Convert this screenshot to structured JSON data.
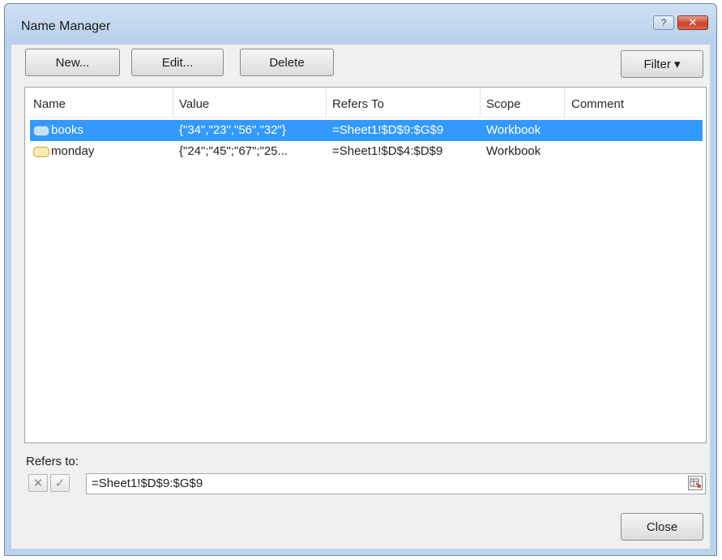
{
  "window": {
    "title": "Name Manager",
    "help_glyph": "?",
    "close_glyph": "✕"
  },
  "toolbar": {
    "new_label": "New...",
    "edit_label": "Edit...",
    "delete_label": "Delete",
    "filter_label": "Filter ▾"
  },
  "table": {
    "columns": [
      "Name",
      "Value",
      "Refers To",
      "Scope",
      "Comment"
    ],
    "rows": [
      {
        "name": "books",
        "value": "{\"34\",\"23\",\"56\",\"32\"}",
        "refers_to": "=Sheet1!$D$9:$G$9",
        "scope": "Workbook",
        "comment": "",
        "selected": true,
        "icon": "range-name-icon"
      },
      {
        "name": "monday",
        "value": "{\"24\";\"45\";\"67\";\"25...",
        "refers_to": "=Sheet1!$D$4:$D$9",
        "scope": "Workbook",
        "comment": "",
        "selected": false,
        "icon": "range-name-icon"
      }
    ]
  },
  "refers_panel": {
    "label": "Refers to:",
    "value": "=Sheet1!$D$9:$G$9",
    "cancel_glyph": "✕",
    "confirm_glyph": "✓"
  },
  "footer": {
    "close_label": "Close"
  },
  "colors": {
    "selection": "#3399ff",
    "title_bar": "#bcd3ec",
    "close_button": "#c8422a"
  }
}
